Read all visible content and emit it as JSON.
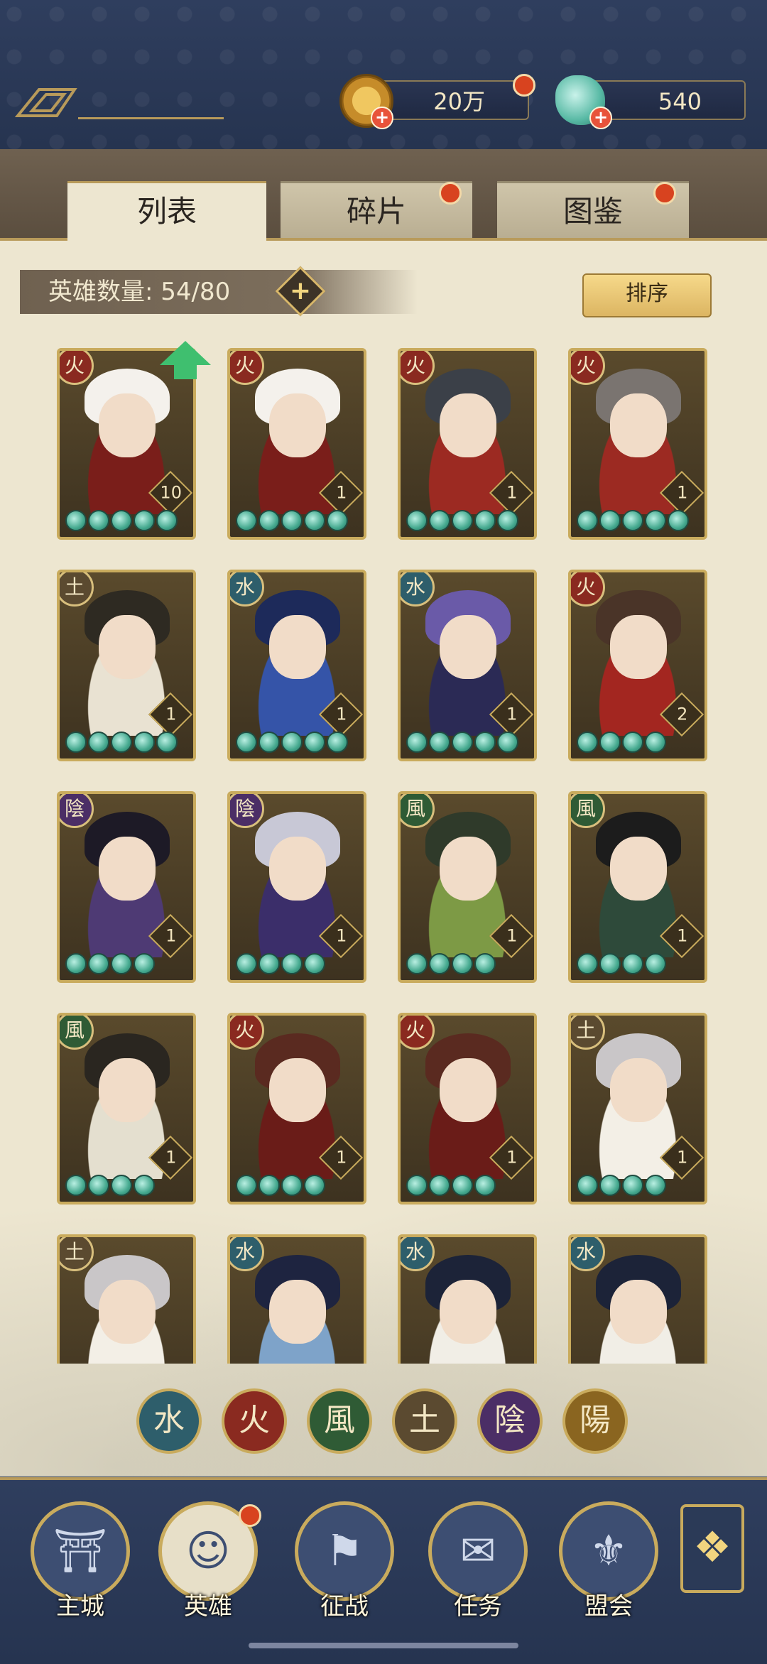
{
  "currency": {
    "copper": "20万",
    "jade": "540"
  },
  "tabs": [
    {
      "label": "列表",
      "active": true,
      "badge": false
    },
    {
      "label": "碎片",
      "active": false,
      "badge": true
    },
    {
      "label": "图鉴",
      "active": false,
      "badge": true
    }
  ],
  "hero_count": {
    "label": "英雄数量: 54/80"
  },
  "sort_label": "排序",
  "element_colors": {
    "水": "#2e5e6b",
    "火": "#8a2a20",
    "風": "#2f5b35",
    "土": "#5b4a30",
    "陰": "#4b2e66",
    "陽": "#8a6520"
  },
  "heroes": [
    {
      "element": "火",
      "level": "10",
      "stars": 5,
      "hair": "#f4f1ec",
      "accent": "#7a1e1a"
    },
    {
      "element": "火",
      "level": "1",
      "stars": 5,
      "hair": "#f4f1ec",
      "accent": "#7a1e1a"
    },
    {
      "element": "火",
      "level": "1",
      "stars": 5,
      "hair": "#3b4048",
      "accent": "#9c2a22"
    },
    {
      "element": "火",
      "level": "1",
      "stars": 5,
      "hair": "#7a7470",
      "accent": "#9c2a22"
    },
    {
      "element": "土",
      "level": "1",
      "stars": 5,
      "hair": "#2e2a22",
      "accent": "#e9e2d2"
    },
    {
      "element": "水",
      "level": "1",
      "stars": 5,
      "hair": "#1d2a5a",
      "accent": "#3554a8"
    },
    {
      "element": "水",
      "level": "1",
      "stars": 5,
      "hair": "#6a5aa8",
      "accent": "#2b2a55"
    },
    {
      "element": "火",
      "level": "2",
      "stars": 4,
      "hair": "#4a3428",
      "accent": "#a32620"
    },
    {
      "element": "陰",
      "level": "1",
      "stars": 4,
      "hair": "#1d1a26",
      "accent": "#4e3a74"
    },
    {
      "element": "陰",
      "level": "1",
      "stars": 4,
      "hair": "#c8c8d6",
      "accent": "#3b2e6a"
    },
    {
      "element": "風",
      "level": "1",
      "stars": 4,
      "hair": "#2f3a2a",
      "accent": "#7d9a45"
    },
    {
      "element": "風",
      "level": "1",
      "stars": 4,
      "hair": "#1c1c1c",
      "accent": "#2e4a3a"
    },
    {
      "element": "風",
      "level": "1",
      "stars": 4,
      "hair": "#2a2620",
      "accent": "#e4dfcf"
    },
    {
      "element": "火",
      "level": "1",
      "stars": 4,
      "hair": "#5a2a20",
      "accent": "#6a1c18"
    },
    {
      "element": "火",
      "level": "1",
      "stars": 4,
      "hair": "#5a2a20",
      "accent": "#6a1c18"
    },
    {
      "element": "土",
      "level": "1",
      "stars": 4,
      "hair": "#c9c6c8",
      "accent": "#f3efe6"
    },
    {
      "element": "土",
      "level": "",
      "stars": 0,
      "hair": "#c9c6c8",
      "accent": "#f3efe6"
    },
    {
      "element": "水",
      "level": "",
      "stars": 0,
      "hair": "#1e2440",
      "accent": "#7ea3c9"
    },
    {
      "element": "水",
      "level": "",
      "stars": 0,
      "hair": "#1c2338",
      "accent": "#f1eee6"
    },
    {
      "element": "水",
      "level": "",
      "stars": 0,
      "hair": "#1c2338",
      "accent": "#f1eee6"
    }
  ],
  "filters": [
    "水",
    "火",
    "風",
    "土",
    "陰",
    "陽"
  ],
  "nav": [
    {
      "label": "主城",
      "glyph": "⛩",
      "active": false
    },
    {
      "label": "英雄",
      "glyph": "☺",
      "active": true,
      "badge": true
    },
    {
      "label": "征战",
      "glyph": "⚑",
      "active": false
    },
    {
      "label": "任务",
      "glyph": "✉",
      "active": false
    },
    {
      "label": "盟会",
      "glyph": "⚜",
      "active": false
    }
  ],
  "more_glyph": "❖"
}
